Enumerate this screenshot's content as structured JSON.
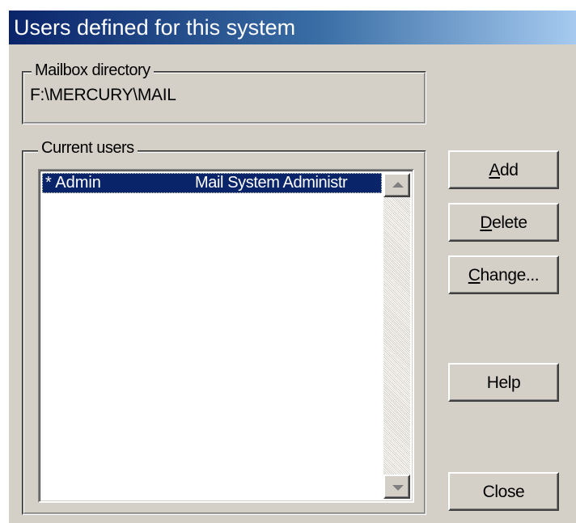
{
  "window": {
    "title": "Users defined for this system"
  },
  "mailbox": {
    "legend": "Mailbox directory",
    "path": "F:\\MERCURY\\MAIL"
  },
  "users": {
    "legend": "Current users",
    "rows": [
      {
        "name": "* Admin",
        "description": "Mail System Administr",
        "selected": true
      }
    ]
  },
  "buttons": {
    "add": {
      "mnemonic": "A",
      "rest": "dd"
    },
    "delete": {
      "mnemonic": "D",
      "rest": "elete"
    },
    "change": {
      "mnemonic": "C",
      "rest": "hange..."
    },
    "help": "Help",
    "close": "Close"
  },
  "colors": {
    "dialog_bg": "#d4d0c8",
    "title_gradient_start": "#0a246a",
    "title_gradient_end": "#a6caf0",
    "selection": "#0a246a"
  },
  "icons": {
    "scroll_up": "triangle-up",
    "scroll_down": "triangle-down"
  }
}
